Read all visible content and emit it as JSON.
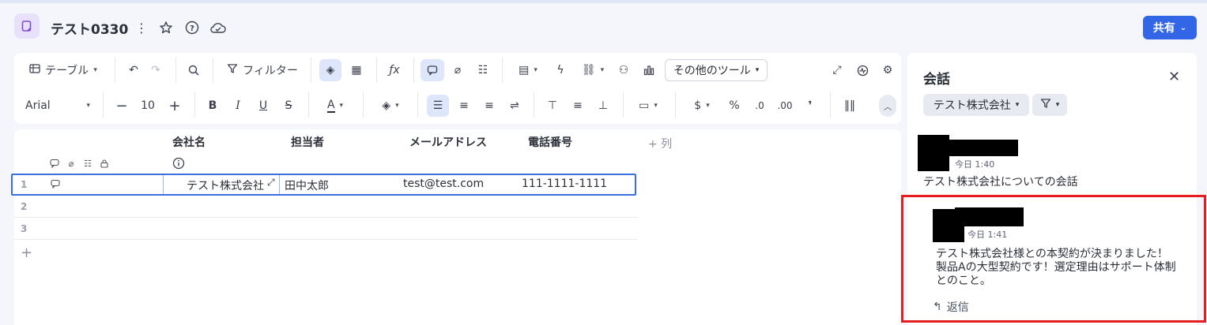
{
  "header": {
    "title": "テスト0330",
    "share_label": "共有"
  },
  "toolbar": {
    "view_label": "テーブル",
    "filter_label": "フィルター",
    "other_tools_label": "その他のツール",
    "font_name": "Arial",
    "font_size": "10",
    "currency_symbol": "$",
    "percent_symbol": "%"
  },
  "grid": {
    "columns": [
      "会社名",
      "担当者",
      "メールアドレス",
      "電話番号"
    ],
    "add_column_label": "+ 列",
    "rows": [
      {
        "num": "1",
        "company": "テスト株式会社",
        "person": "田中太郎",
        "email": "test@test.com",
        "phone": "111-1111-1111"
      },
      {
        "num": "2"
      },
      {
        "num": "3"
      }
    ],
    "add_row_label": "+"
  },
  "panel": {
    "title": "会話",
    "filter_company": "テスト株式会社",
    "thread": {
      "timestamp": "今日 1:40",
      "text": "テスト株式会社についての会話"
    },
    "comment": {
      "timestamp": "今日 1:41",
      "line1": "テスト株式会社様との本契約が決まりました！",
      "line2": "製品Aの大型契約です！選定理由はサポート体制",
      "line3": "とのこと。"
    },
    "reply_label": "返信"
  },
  "colors": {
    "accent": "#3366e6",
    "highlight": "#e41e1e"
  }
}
